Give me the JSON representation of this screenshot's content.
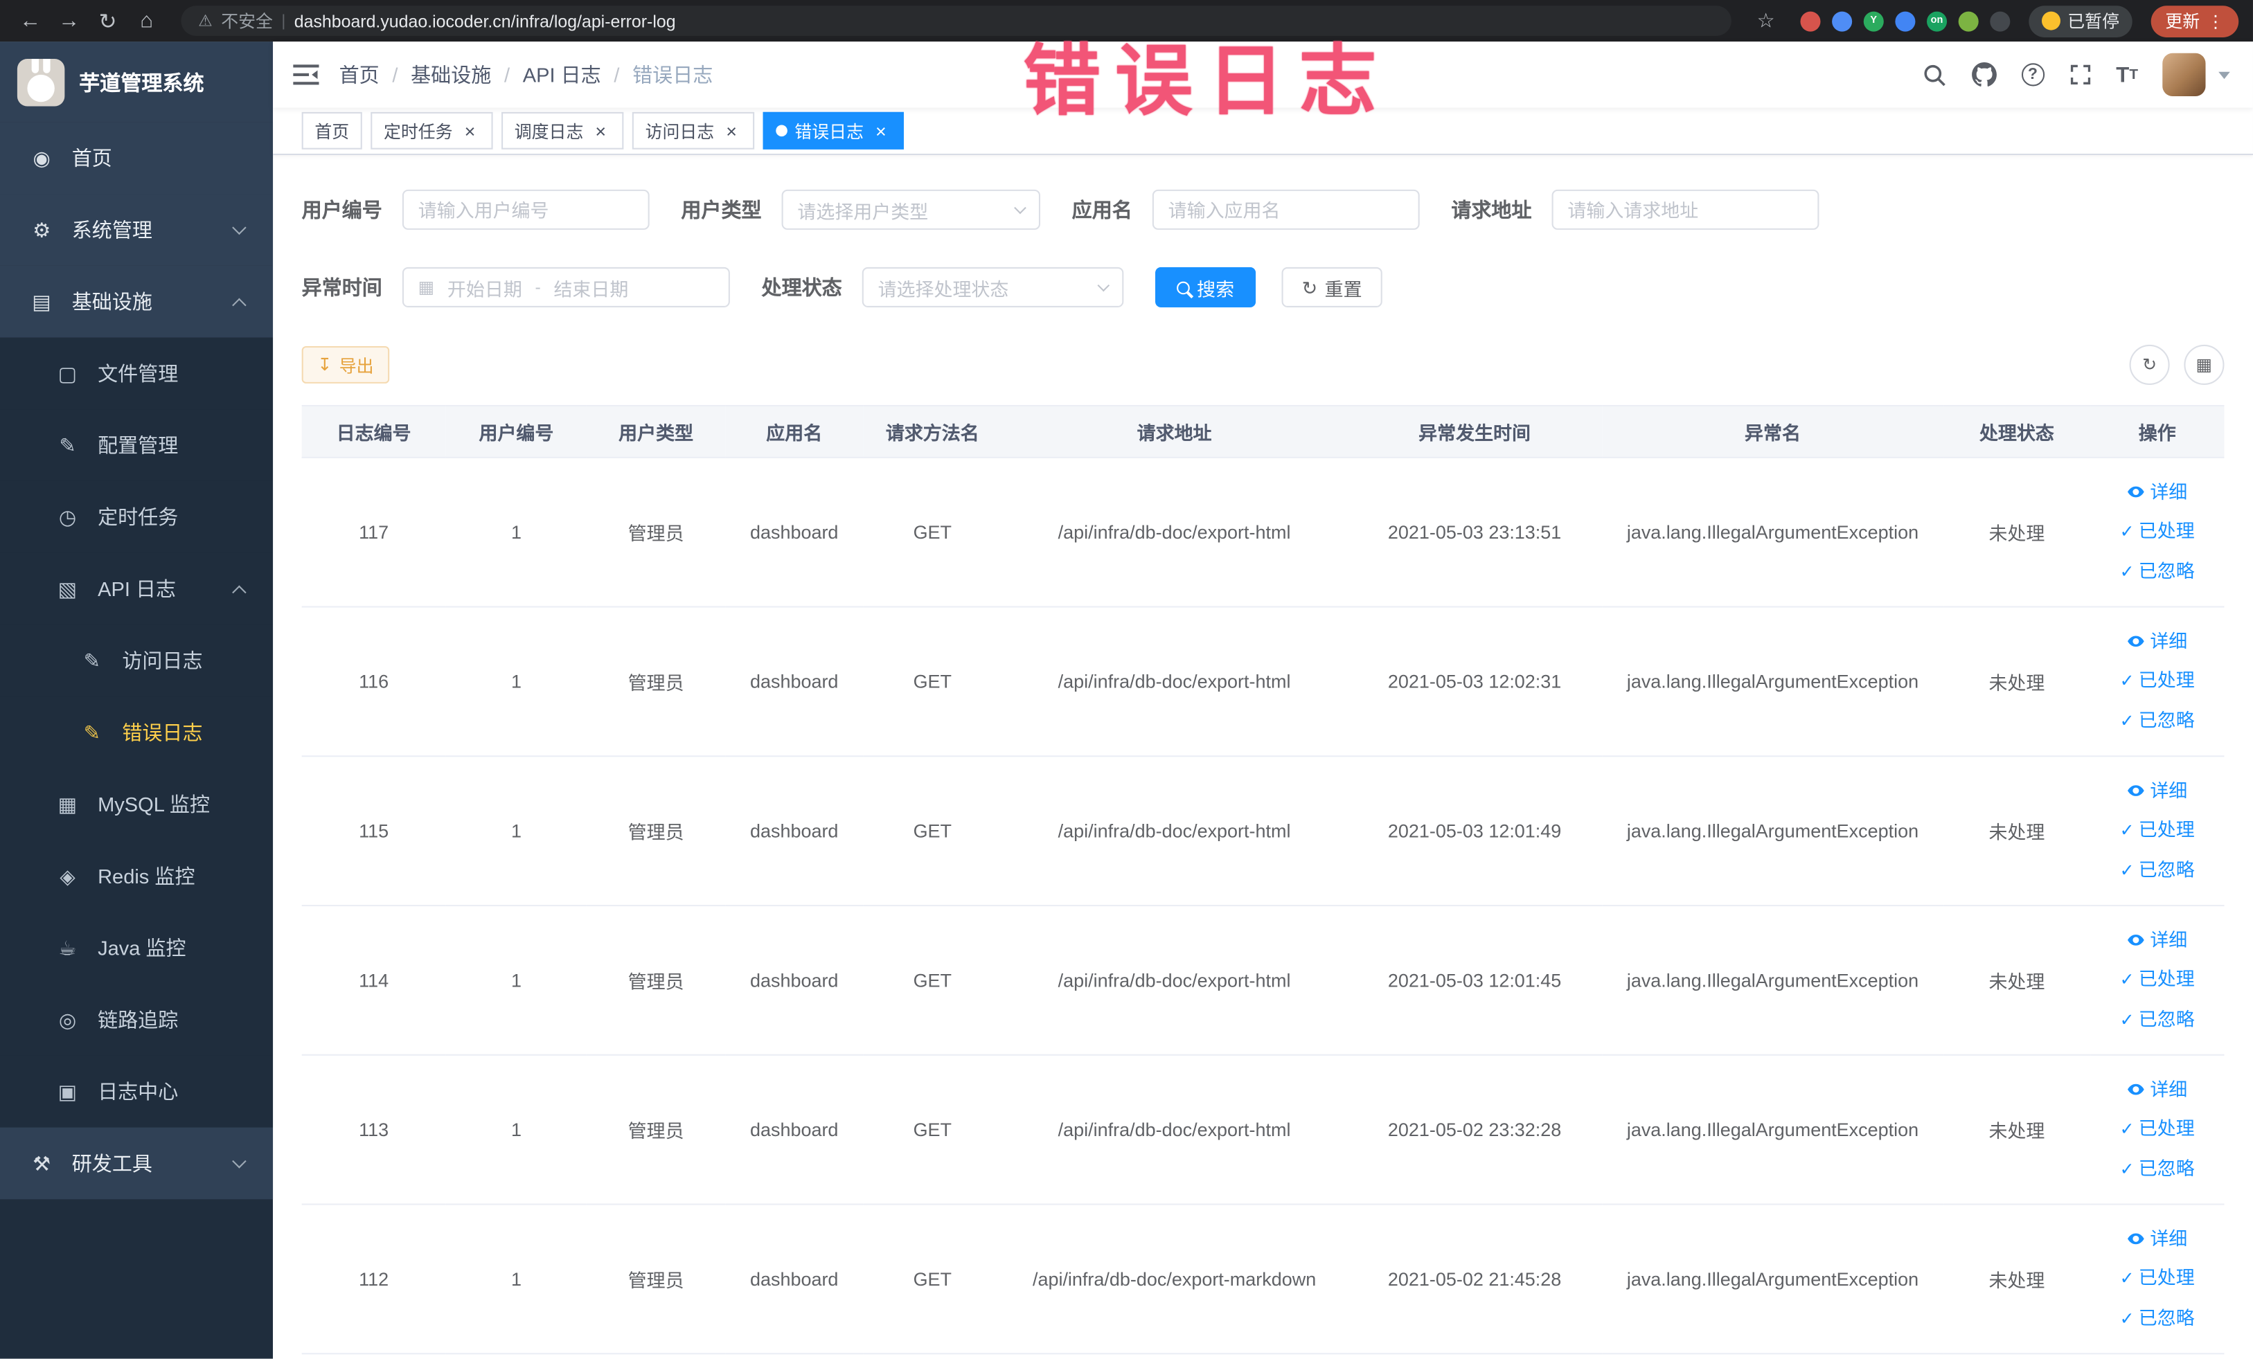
{
  "browser": {
    "security_label": "不安全",
    "url": "dashboard.yudao.iocoder.cn/infra/log/api-error-log",
    "paused_label": "已暂停",
    "update_label": "更新",
    "extensions": [
      {
        "name": "extension-red-ball",
        "color": "#d7544c",
        "text": ""
      },
      {
        "name": "extension-blue-drop",
        "color": "#4f8df5",
        "text": ""
      },
      {
        "name": "extension-green-y",
        "color": "#2bab5e",
        "text": "Y"
      },
      {
        "name": "extension-blue-grid",
        "color": "#4285f4",
        "text": ""
      },
      {
        "name": "extension-on-badge",
        "color": "#1aa260",
        "text": "on"
      },
      {
        "name": "extension-leaf",
        "color": "#7cb342",
        "text": ""
      },
      {
        "name": "extension-paw",
        "color": "#44484d",
        "text": ""
      }
    ]
  },
  "annotation": {
    "text": "错误日志",
    "color": "#f25577"
  },
  "sidebar": {
    "logo_title": "芋道管理系统",
    "items": [
      {
        "id": "home",
        "label": "首页",
        "icon": "home",
        "level": 1
      },
      {
        "id": "system",
        "label": "系统管理",
        "icon": "gear",
        "level": 1,
        "arrow": "down"
      },
      {
        "id": "infra",
        "label": "基础设施",
        "icon": "infra",
        "level": 1,
        "arrow": "up"
      },
      {
        "id": "file",
        "label": "文件管理",
        "icon": "file",
        "level": 2
      },
      {
        "id": "config",
        "label": "配置管理",
        "icon": "config",
        "level": 2
      },
      {
        "id": "job",
        "label": "定时任务",
        "icon": "cron",
        "level": 2
      },
      {
        "id": "api-log",
        "label": "API 日志",
        "icon": "api",
        "level": 2,
        "arrow": "up"
      },
      {
        "id": "access-log",
        "label": "访问日志",
        "icon": "doc",
        "level": 3
      },
      {
        "id": "error-log",
        "label": "错误日志",
        "icon": "doc",
        "level": 3,
        "active": true
      },
      {
        "id": "mysql",
        "label": "MySQL 监控",
        "icon": "mysql",
        "level": 2
      },
      {
        "id": "redis",
        "label": "Redis 监控",
        "icon": "redis",
        "level": 2
      },
      {
        "id": "java",
        "label": "Java 监控",
        "icon": "java",
        "level": 2
      },
      {
        "id": "trace",
        "label": "链路追踪",
        "icon": "trace",
        "level": 2
      },
      {
        "id": "log-center",
        "label": "日志中心",
        "icon": "log",
        "level": 2
      },
      {
        "id": "devtools",
        "label": "研发工具",
        "icon": "tools",
        "level": 1,
        "arrow": "down"
      }
    ]
  },
  "header": {
    "breadcrumb": [
      "首页",
      "基础设施",
      "API 日志",
      "错误日志"
    ]
  },
  "tabs": [
    {
      "id": "home",
      "label": "首页",
      "closable": false,
      "active": false
    },
    {
      "id": "job",
      "label": "定时任务",
      "closable": true,
      "active": false
    },
    {
      "id": "job-log",
      "label": "调度日志",
      "closable": true,
      "active": false
    },
    {
      "id": "access-log",
      "label": "访问日志",
      "closable": true,
      "active": false
    },
    {
      "id": "error-log",
      "label": "错误日志",
      "closable": true,
      "active": true
    }
  ],
  "filters": {
    "user_id": {
      "label": "用户编号",
      "placeholder": "请输入用户编号"
    },
    "user_type": {
      "label": "用户类型",
      "placeholder": "请选择用户类型"
    },
    "app_name": {
      "label": "应用名",
      "placeholder": "请输入应用名"
    },
    "request_url": {
      "label": "请求地址",
      "placeholder": "请输入请求地址"
    },
    "exception_time": {
      "label": "异常时间",
      "start_placeholder": "开始日期",
      "separator": "-",
      "end_placeholder": "结束日期"
    },
    "process_status": {
      "label": "处理状态",
      "placeholder": "请选择处理状态"
    },
    "search_label": "搜索",
    "reset_label": "重置"
  },
  "toolbar": {
    "export_label": "导出"
  },
  "table": {
    "columns": [
      "日志编号",
      "用户编号",
      "用户类型",
      "应用名",
      "请求方法名",
      "请求地址",
      "异常发生时间",
      "异常名",
      "处理状态",
      "操作"
    ],
    "actions": [
      {
        "id": "detail",
        "label": "详细",
        "icon": "eye"
      },
      {
        "id": "mark-processed",
        "label": "已处理",
        "icon": "check"
      },
      {
        "id": "mark-ignored",
        "label": "已忽略",
        "icon": "check"
      }
    ],
    "rows": [
      {
        "id": "117",
        "user_id": "1",
        "user_type": "管理员",
        "app": "dashboard",
        "method": "GET",
        "url": "/api/infra/db-doc/export-html",
        "time": "2021-05-03 23:13:51",
        "exception": "java.lang.IllegalArgumentException",
        "status": "未处理"
      },
      {
        "id": "116",
        "user_id": "1",
        "user_type": "管理员",
        "app": "dashboard",
        "method": "GET",
        "url": "/api/infra/db-doc/export-html",
        "time": "2021-05-03 12:02:31",
        "exception": "java.lang.IllegalArgumentException",
        "status": "未处理"
      },
      {
        "id": "115",
        "user_id": "1",
        "user_type": "管理员",
        "app": "dashboard",
        "method": "GET",
        "url": "/api/infra/db-doc/export-html",
        "time": "2021-05-03 12:01:49",
        "exception": "java.lang.IllegalArgumentException",
        "status": "未处理"
      },
      {
        "id": "114",
        "user_id": "1",
        "user_type": "管理员",
        "app": "dashboard",
        "method": "GET",
        "url": "/api/infra/db-doc/export-html",
        "time": "2021-05-03 12:01:45",
        "exception": "java.lang.IllegalArgumentException",
        "status": "未处理"
      },
      {
        "id": "113",
        "user_id": "1",
        "user_type": "管理员",
        "app": "dashboard",
        "method": "GET",
        "url": "/api/infra/db-doc/export-html",
        "time": "2021-05-02 23:32:28",
        "exception": "java.lang.IllegalArgumentException",
        "status": "未处理"
      },
      {
        "id": "112",
        "user_id": "1",
        "user_type": "管理员",
        "app": "dashboard",
        "method": "GET",
        "url": "/api/infra/db-doc/export-markdown",
        "time": "2021-05-02 21:45:28",
        "exception": "java.lang.IllegalArgumentException",
        "status": "未处理"
      }
    ]
  },
  "theme": {
    "accent": "#1890ff",
    "sidebar_bg": "#1f2d3d",
    "menu_bg": "#304156",
    "active_text": "#ffd04b",
    "warning": "#e6a23c"
  }
}
